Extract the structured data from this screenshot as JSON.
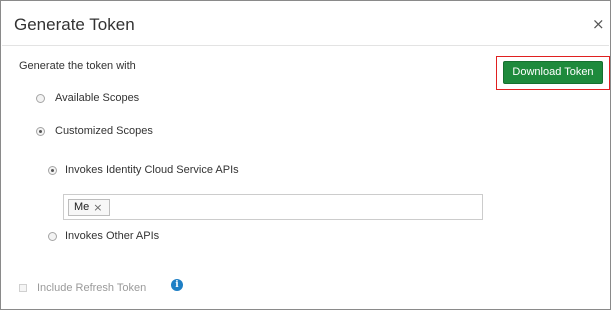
{
  "dialog": {
    "title": "Generate Token",
    "close_glyph": "×"
  },
  "form": {
    "main_label": "Generate the token with",
    "download_button": "Download Token",
    "scope_options": [
      {
        "label": "Available Scopes",
        "checked": false
      },
      {
        "label": "Customized Scopes",
        "checked": true
      }
    ],
    "sub_options": [
      {
        "label": "Invokes Identity Cloud Service APIs",
        "checked": true
      },
      {
        "label": "Invokes Other APIs",
        "checked": false
      }
    ],
    "selected_tokens": [
      "Me"
    ],
    "chip_remove_glyph": "×",
    "refresh_token": {
      "label": "Include Refresh Token",
      "checked": false,
      "disabled": true
    },
    "info_icon_glyph": "i"
  },
  "colors": {
    "primary_button": "#1e8a3c",
    "highlight_border": "#e02020",
    "info_icon": "#1e7fc5"
  },
  "icons": [
    "close-icon",
    "radio-icon",
    "remove-chip-icon",
    "info-icon",
    "checkbox-icon"
  ]
}
